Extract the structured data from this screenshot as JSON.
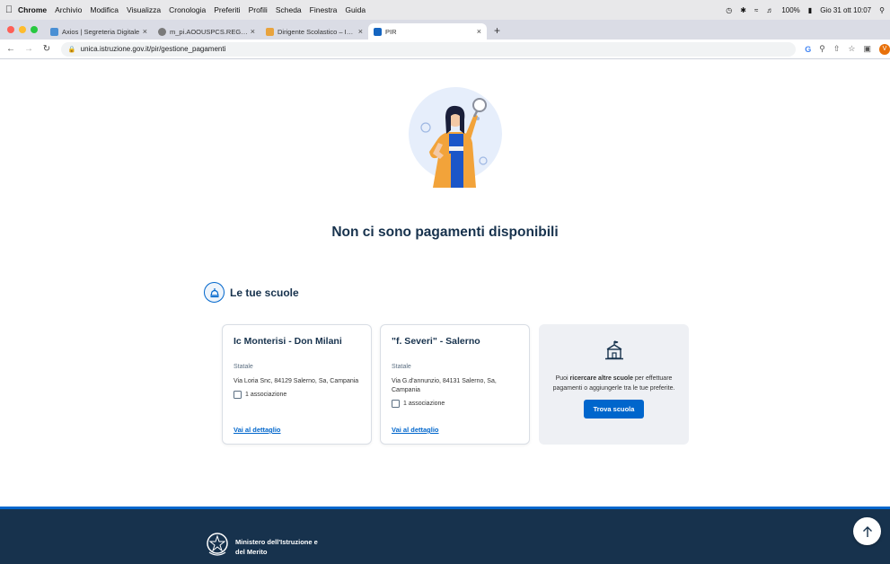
{
  "menubar": {
    "items": [
      "Chrome",
      "Archivio",
      "Modifica",
      "Visualizza",
      "Cronologia",
      "Preferiti",
      "Profili",
      "Scheda",
      "Finestra",
      "Guida"
    ],
    "battery": "100%",
    "datetime": "Gio 31 ott 10:07"
  },
  "tabs": [
    {
      "label": "Axios | Segreteria Digitale",
      "favicon_color": "#4a8fd4"
    },
    {
      "label": "m_pi.AOOUSPCS.REGISTRO_U...",
      "favicon_color": "#7a7a7a"
    },
    {
      "label": "Dirigente Scolastico – IPSEOA",
      "favicon_color": "#e8a33d"
    },
    {
      "label": "PIR",
      "favicon_color": "#1565c0",
      "active": true
    }
  ],
  "address": {
    "url": "unica.istruzione.gov.it/pir/gestione_pagamenti"
  },
  "main": {
    "headline": "Non ci sono pagamenti disponibili",
    "section_title": "Le tue scuole",
    "schools": [
      {
        "name": "Ic Monterisi - Don Milani",
        "type": "Statale",
        "address": "Via Loria Snc, 84129 Salerno, Sa, Campania",
        "associations": "1 associazione",
        "link": "Vai al dettaglio"
      },
      {
        "name": "\"f. Severi\" - Salerno",
        "type": "Statale",
        "address": "Via G.d'annunzio, 84131 Salerno, Sa, Campania",
        "associations": "1 associazione",
        "link": "Vai al dettaglio"
      }
    ],
    "search_card": {
      "text_before": "Puoi ",
      "text_bold": "ricercare altre scuole",
      "text_after": " per effettuare pagamenti o aggiungerle tra le tue preferite.",
      "button": "Trova scuola"
    }
  },
  "footer": {
    "ministry_line1": "Ministero dell'Istruzione e",
    "ministry_line2": "del Merito"
  },
  "colors": {
    "primary": "#0066cc",
    "dark_blue": "#17324d"
  }
}
